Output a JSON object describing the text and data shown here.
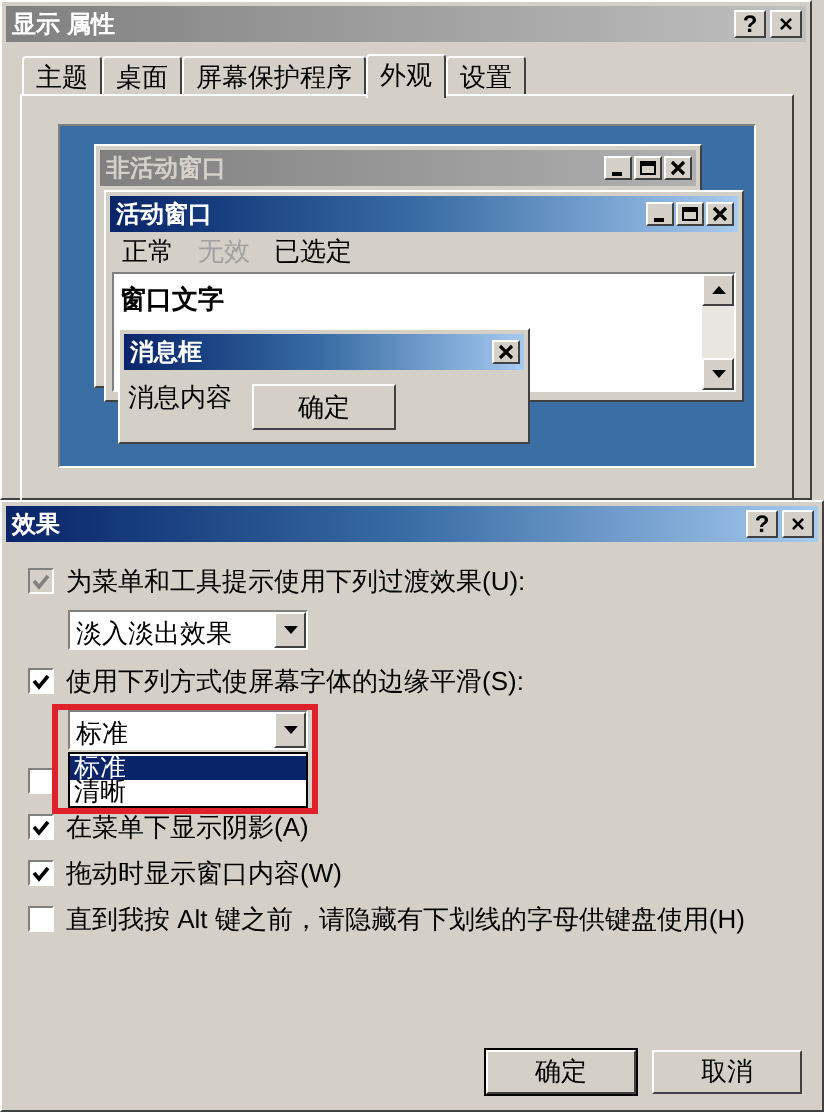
{
  "back_window": {
    "title": "显示 属性",
    "caption_buttons": [
      "?",
      "×"
    ],
    "tabs": [
      {
        "label": "主题",
        "selected": false
      },
      {
        "label": "桌面",
        "selected": false
      },
      {
        "label": "屏幕保护程序",
        "selected": false
      },
      {
        "label": "外观",
        "selected": true
      },
      {
        "label": "设置",
        "selected": false
      }
    ],
    "preview": {
      "inactive_window": {
        "title": "非活动窗口"
      },
      "active_window": {
        "title": "活动窗口",
        "menu": [
          {
            "label": "正常",
            "disabled": false
          },
          {
            "label": "无效",
            "disabled": true
          },
          {
            "label": "已选定",
            "disabled": false
          }
        ],
        "window_text": "窗口文字"
      },
      "message_box": {
        "title": "消息框",
        "message": "消息内容",
        "button": "确定"
      }
    }
  },
  "dialog": {
    "title": "效果",
    "caption_buttons": [
      "?",
      "×"
    ],
    "options": [
      {
        "label": "为菜单和工具提示使用下列过渡效果(U):",
        "checked": true,
        "disabled": true,
        "dropdown": {
          "value": "淡入淡出效果"
        }
      },
      {
        "label": "使用下列方式使屏幕字体的边缘平滑(S):",
        "checked": true,
        "disabled": false,
        "dropdown": {
          "value": "标准",
          "open": true,
          "annotated": true,
          "options": [
            {
              "label": "标准",
              "selected": true
            },
            {
              "label": "清晰",
              "selected": false
            }
          ]
        }
      },
      {
        "checked": false,
        "disabled": false
      },
      {
        "label": "在菜单下显示阴影(A)",
        "checked": true,
        "disabled": false
      },
      {
        "label": "拖动时显示窗口内容(W)",
        "checked": true,
        "disabled": false
      },
      {
        "label": "直到我按 Alt 键之前，请隐藏有下划线的字母供键盘使用(H)",
        "checked": false,
        "disabled": false
      }
    ],
    "buttons": [
      {
        "label": "确定",
        "default": true
      },
      {
        "label": "取消",
        "default": false
      }
    ]
  }
}
